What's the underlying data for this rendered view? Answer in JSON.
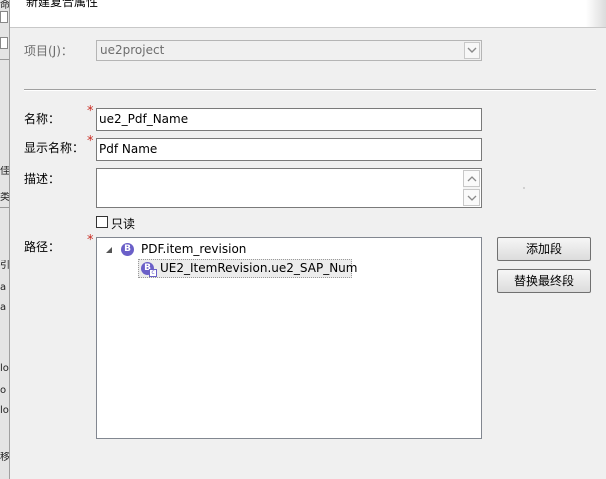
{
  "title": "新建复合属性",
  "left_fragments": [
    "命",
    "佳",
    "类",
    "引",
    "a",
    "a",
    "lo",
    "o",
    "lo",
    "移"
  ],
  "project": {
    "label": "项目(J)：",
    "value": "ue2project"
  },
  "name": {
    "label": "名称：",
    "value": "ue2_Pdf_Name",
    "required": true
  },
  "display_name": {
    "label": "显示名称：",
    "value": "Pdf Name",
    "required": true
  },
  "description": {
    "label": "描述：",
    "value": ""
  },
  "readonly": {
    "label": "只读",
    "checked": false
  },
  "path": {
    "label": "路径：",
    "required": true,
    "tree": {
      "root": {
        "label": "PDF.item_revision",
        "icon": "business-object-icon",
        "expanded": true
      },
      "child": {
        "label": "UE2_ItemRevision.ue2_SAP_Num",
        "icon": "compound-property-icon",
        "selected": true
      }
    }
  },
  "buttons": {
    "add_segment": "添加段",
    "replace_last": "替换最终段"
  },
  "colors": {
    "required_star": "#c8281e",
    "object_icon": "#6a5fc8",
    "background": "#f0f0f0"
  }
}
